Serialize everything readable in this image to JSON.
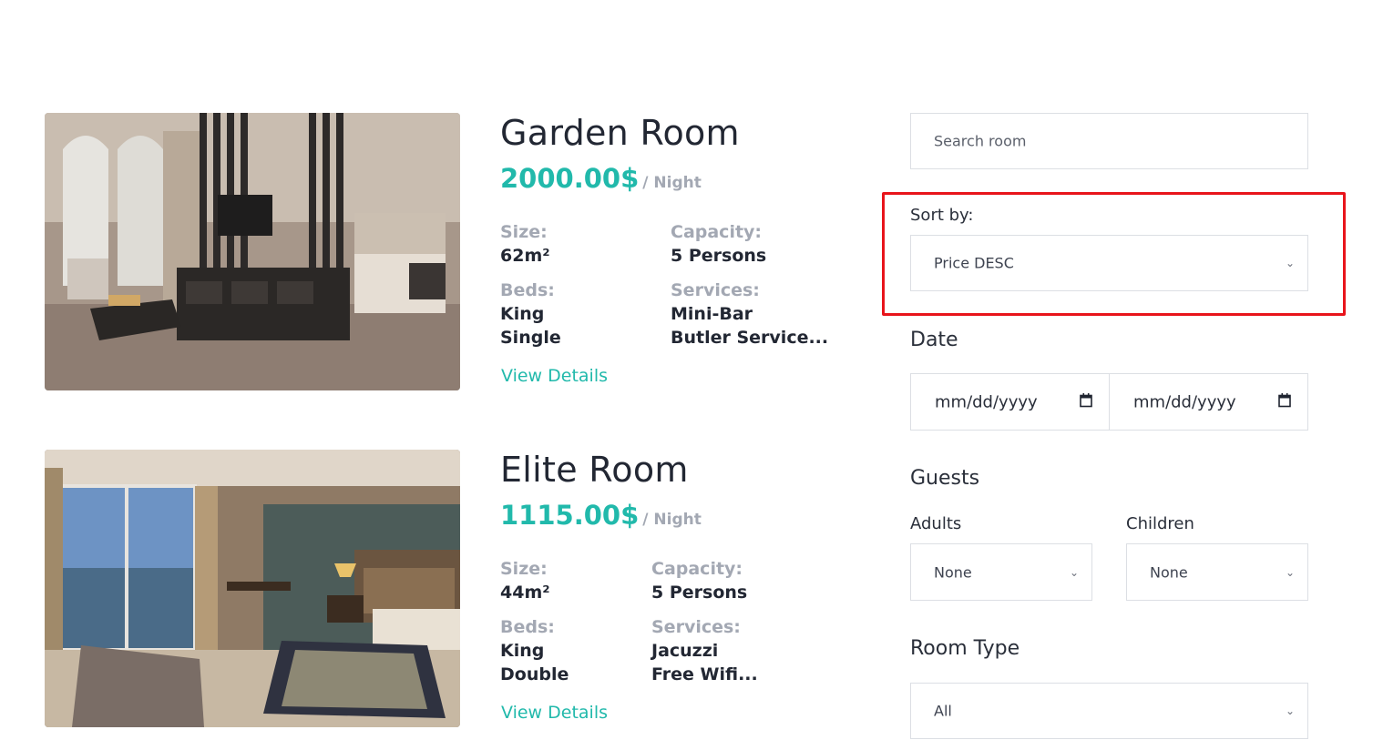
{
  "rooms": [
    {
      "name": "Garden Room",
      "price": "2000.00$",
      "per_night": "/ Night",
      "size_label": "Size:",
      "size": "62m²",
      "capacity_label": "Capacity:",
      "capacity": "5 Persons",
      "beds_label": "Beds:",
      "beds": [
        "King",
        "Single"
      ],
      "services_label": "Services:",
      "services": [
        "Mini-Bar",
        "Butler Service..."
      ],
      "view_details": "View Details"
    },
    {
      "name": "Elite Room",
      "price": "1115.00$",
      "per_night": "/ Night",
      "size_label": "Size:",
      "size": "44m²",
      "capacity_label": "Capacity:",
      "capacity": "5 Persons",
      "beds_label": "Beds:",
      "beds": [
        "King",
        "Double"
      ],
      "services_label": "Services:",
      "services": [
        "Jacuzzi",
        "Free Wifi..."
      ],
      "view_details": "View Details"
    }
  ],
  "sidebar": {
    "search_placeholder": "Search room",
    "sort_label": "Sort by:",
    "sort_value": "Price DESC",
    "date_heading": "Date",
    "date_from": "mm/dd/yyyy",
    "date_to": "mm/dd/yyyy",
    "guests_heading": "Guests",
    "adults_label": "Adults",
    "adults_value": "None",
    "children_label": "Children",
    "children_value": "None",
    "room_type_heading": "Room Type",
    "room_type_value": "All"
  },
  "colors": {
    "accent": "#21b9ab",
    "muted": "#a3a8b3",
    "highlight": "#e8141b"
  }
}
